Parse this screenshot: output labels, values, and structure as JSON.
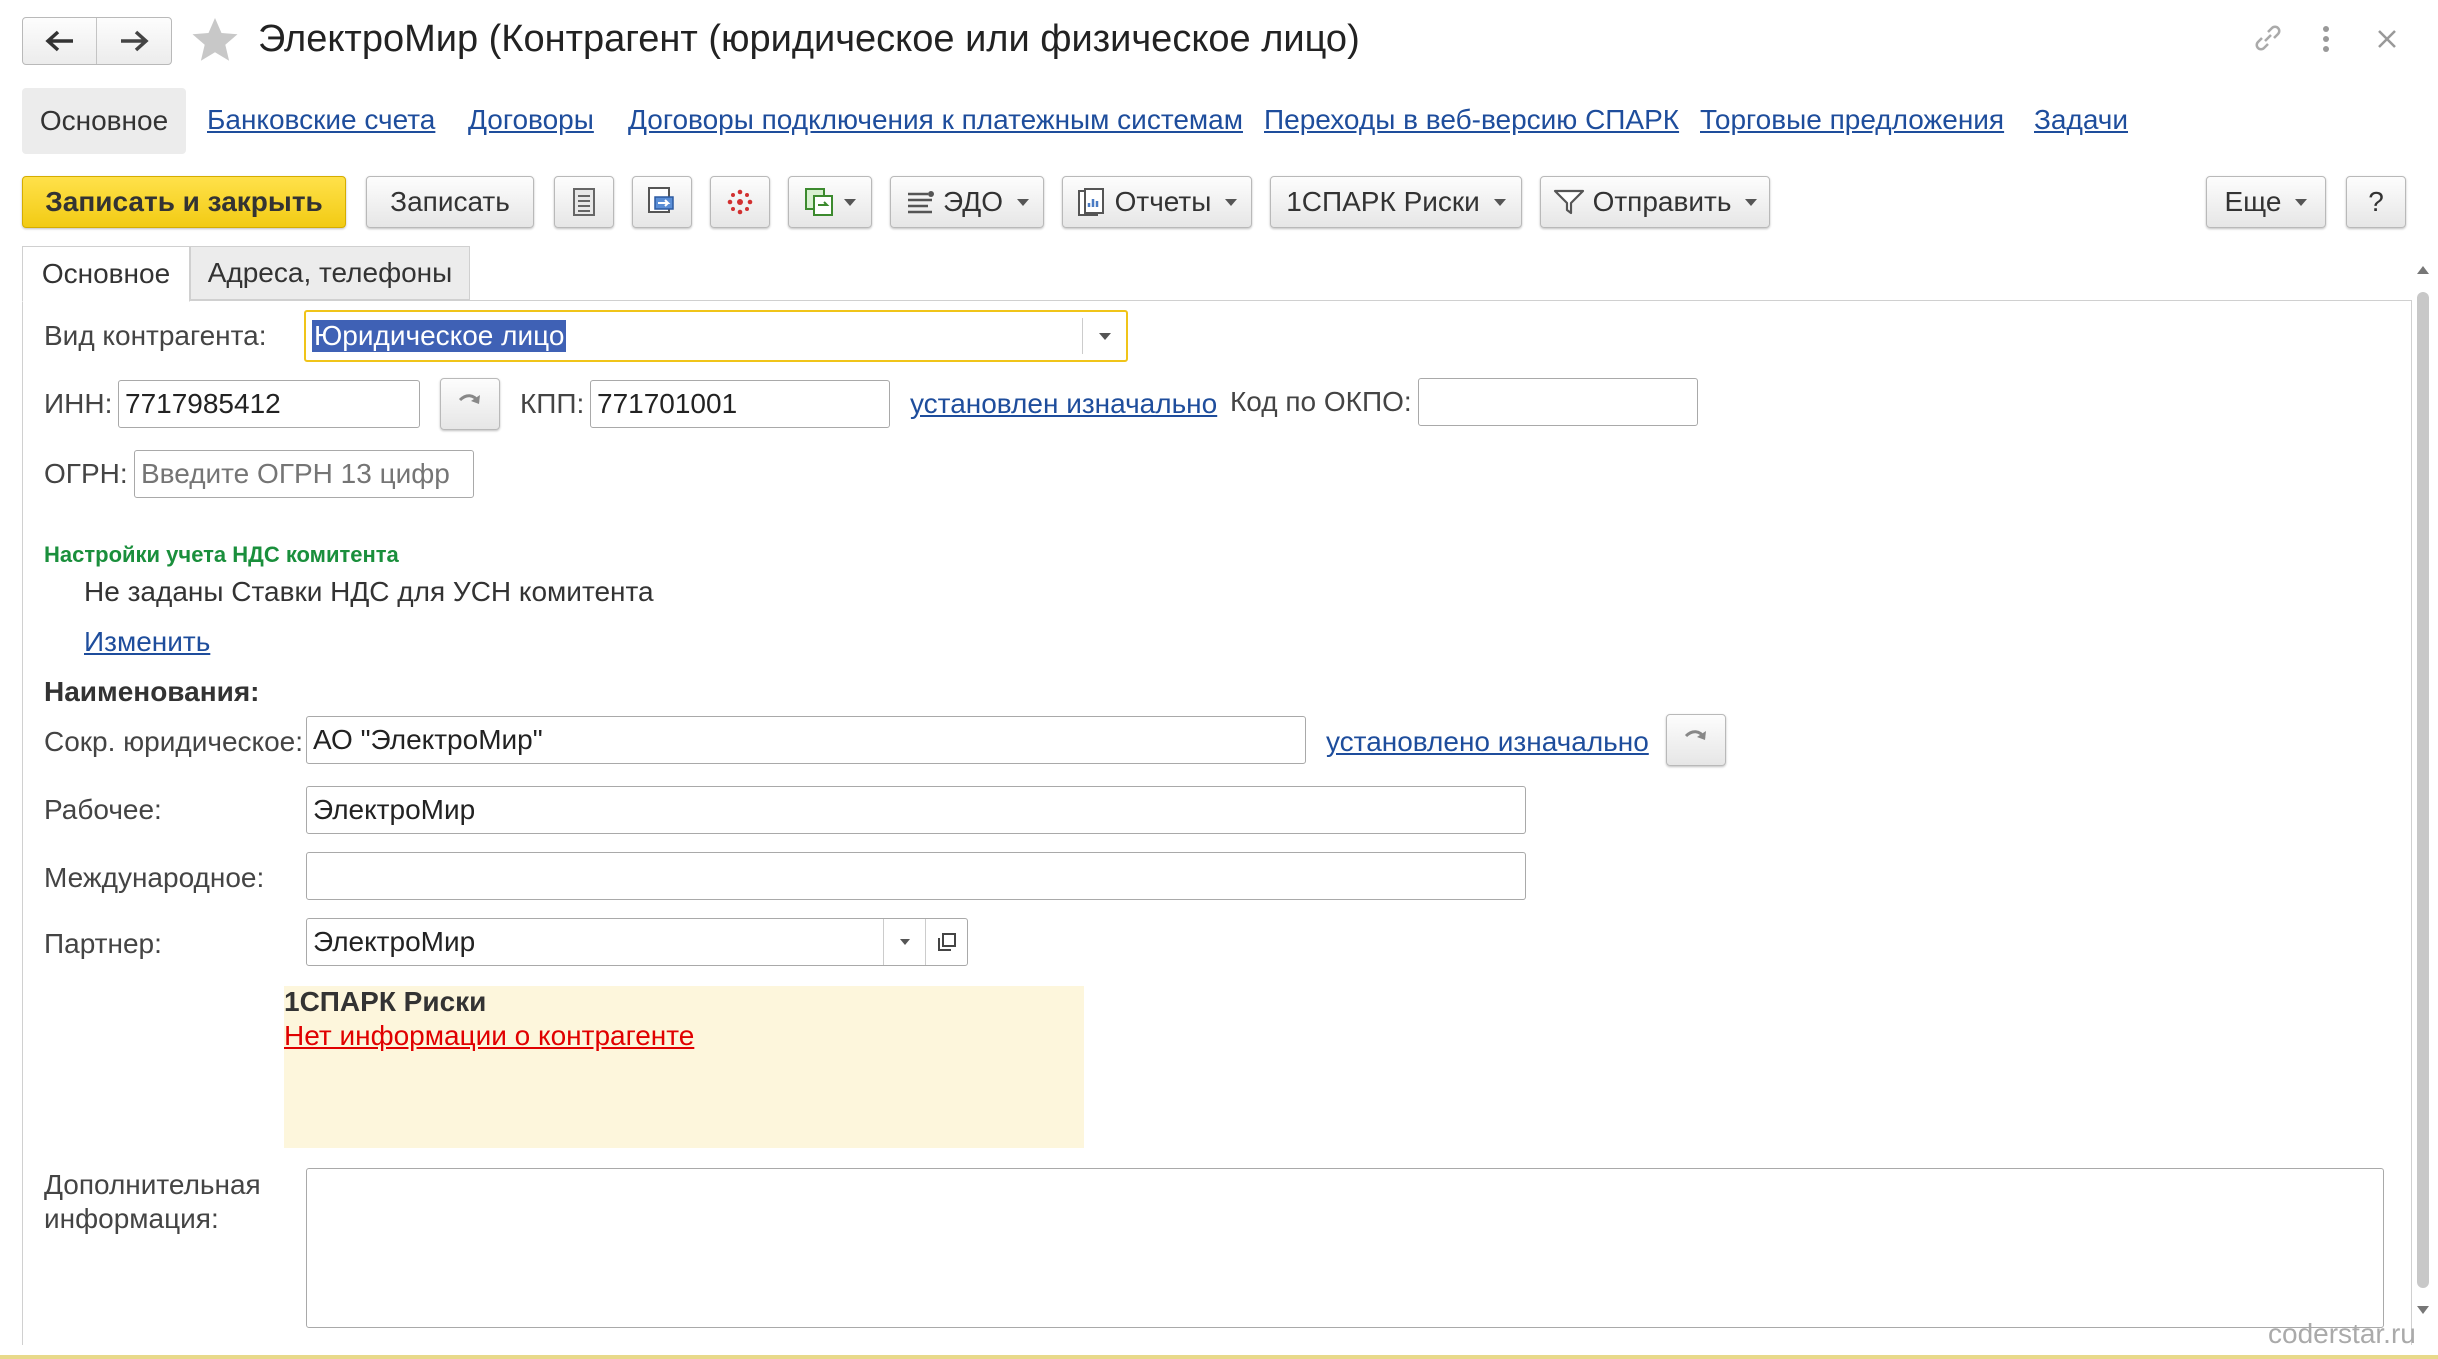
{
  "window": {
    "title": "ЭлектроМир (Контрагент (юридическое или физическое лицо)",
    "watermark": "coderstar.ru"
  },
  "nav_tabs": [
    {
      "label": "Основное",
      "active": true
    },
    {
      "label": "Банковские счета"
    },
    {
      "label": "Договоры"
    },
    {
      "label": "Договоры подключения к платежным системам"
    },
    {
      "label": "Переходы в веб-версию СПАРК"
    },
    {
      "label": "Торговые предложения"
    },
    {
      "label": "Задачи"
    }
  ],
  "toolbar": {
    "save_close": "Записать и закрыть",
    "save": "Записать",
    "edo": "ЭДО",
    "reports": "Отчеты",
    "spark": "1СПАРК Риски",
    "send": "Отправить",
    "more": "Еще",
    "help": "?"
  },
  "form_tabs": [
    {
      "label": "Основное",
      "active": true
    },
    {
      "label": "Адреса, телефоны"
    }
  ],
  "form": {
    "kind_label": "Вид контрагента:",
    "kind_value": "Юридическое лицо",
    "inn_label": "ИНН:",
    "inn_value": "7717985412",
    "kpp_label": "КПП:",
    "kpp_value": "771701001",
    "kpp_link": "установлен изначально",
    "okpo_label": "Код по ОКПО:",
    "okpo_value": "",
    "ogrn_label": "ОГРН:",
    "ogrn_placeholder": "Введите ОГРН 13 цифр",
    "vat_section_title": "Настройки учета НДС комитента",
    "vat_text": "Не заданы Ставки НДС для УСН комитента",
    "vat_change_link": "Изменить",
    "names_title": "Наименования:",
    "short_name_label": "Сокр. юридическое:",
    "short_name_value": "АО \"ЭлектроМир\"",
    "short_name_link": "установлено изначально",
    "work_name_label": "Рабочее:",
    "work_name_value": "ЭлектроМир",
    "intl_name_label": "Международное:",
    "intl_name_value": "",
    "partner_label": "Партнер:",
    "partner_value": "ЭлектроМир",
    "spark_title": "1СПАРК Риски",
    "spark_link": "Нет информации о контрагенте",
    "extra_label": "Дополнительная информация:",
    "extra_value": ""
  },
  "colors": {
    "primary_button": "#f5d32c",
    "link": "#1e4d9c",
    "section_green": "#1a8f3c",
    "spark_bg": "#fdf6dc",
    "spark_link": "#e00000",
    "focus_border": "#f0c419",
    "selection": "#3f61b5"
  }
}
